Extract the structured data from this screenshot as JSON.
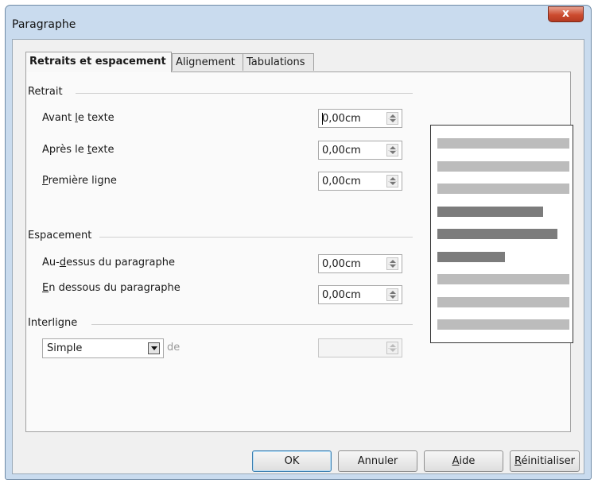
{
  "window": {
    "title": "Paragraphe",
    "close_symbol": "x"
  },
  "tabs": [
    {
      "label": "Retraits et espacement",
      "active": true
    },
    {
      "label": "Alignement",
      "active": false
    },
    {
      "label": "Tabulations",
      "active": false
    }
  ],
  "retrait": {
    "title": "Retrait",
    "avant": {
      "label_pre": "Avant ",
      "label_u": "l",
      "label_post": "e texte",
      "value": "0,00cm"
    },
    "apres": {
      "label_pre": "Après le ",
      "label_u": "t",
      "label_post": "exte",
      "value": "0,00cm"
    },
    "premiere": {
      "label_pre": "",
      "label_u": "P",
      "label_post": "remière ligne",
      "value": "0,00cm"
    }
  },
  "espacement": {
    "title": "Espacement",
    "dessus": {
      "label_pre": "Au-",
      "label_u": "d",
      "label_post": "essus du paragraphe",
      "value": "0,00cm"
    },
    "dessous": {
      "label_pre": "",
      "label_u": "E",
      "label_post": "n dessous du paragraphe",
      "value": "0,00cm"
    }
  },
  "interligne": {
    "title": "Interligne",
    "selected": "Simple",
    "de_label": "de",
    "value": ""
  },
  "preview": {
    "bars": [
      {
        "shade": "light",
        "width_frac": 1.0
      },
      {
        "shade": "light",
        "width_frac": 1.0
      },
      {
        "shade": "light",
        "width_frac": 1.0
      },
      {
        "shade": "dark",
        "width_frac": 0.8
      },
      {
        "shade": "dark",
        "width_frac": 0.91
      },
      {
        "shade": "dark",
        "width_frac": 0.51
      },
      {
        "shade": "light",
        "width_frac": 1.0
      },
      {
        "shade": "light",
        "width_frac": 1.0
      },
      {
        "shade": "light",
        "width_frac": 1.0
      }
    ],
    "light_color": "#bcbcbc",
    "dark_color": "#7c7c7c"
  },
  "buttons": {
    "ok": "OK",
    "annuler": "Annuler",
    "aide_u": "A",
    "aide_rest": "ide",
    "reinit_u": "R",
    "reinit_rest": "éinitialiser"
  }
}
